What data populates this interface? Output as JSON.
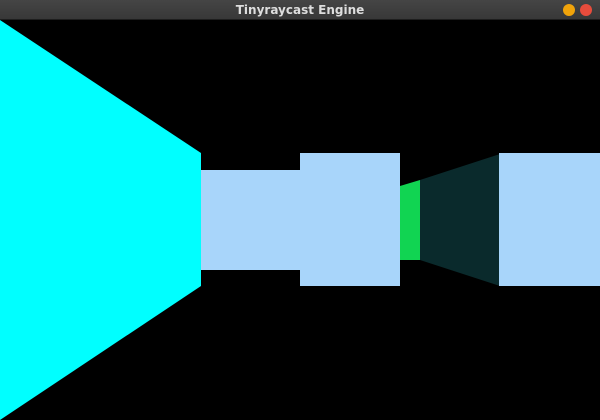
{
  "window": {
    "title": "Tinyraycast Engine",
    "minimize_color": "#f0a30a",
    "close_color": "#e74c3c"
  },
  "scene": {
    "background_color": "#000000",
    "wall_colors": {
      "cyan": "#00ffff",
      "light_blue": "#a8d5fa",
      "green": "#11d452",
      "dark_teal": "#0a2a2c"
    }
  }
}
